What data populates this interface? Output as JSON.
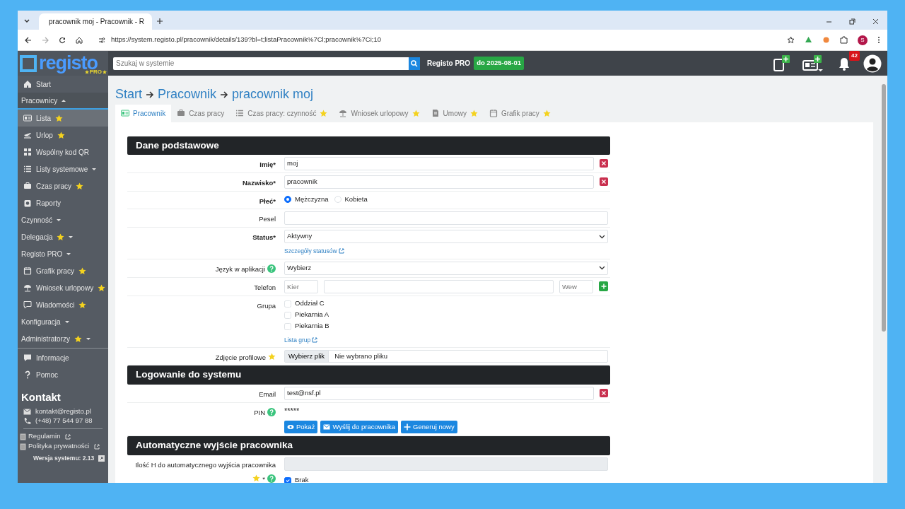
{
  "browser": {
    "tab_title": "pracownik moj - Pracownik - R",
    "url": "https://system.registo.pl/pracownik/details/139?bl=t;listaPracownik%7Cl;pracownik%7Ci;10",
    "profile_initial": "S"
  },
  "header": {
    "logo": "registo",
    "logo_badge": "PRO",
    "search_placeholder": "Szukaj w systemie",
    "plan": "Registo PRO",
    "expiry": "do 2025-08-01",
    "notifications": "42"
  },
  "sidebar": {
    "items": [
      {
        "kind": "link",
        "label": "Start",
        "starred": false,
        "selected": false
      },
      {
        "kind": "section",
        "label": "Pracownicy",
        "expanded": true
      },
      {
        "kind": "link",
        "label": "Lista",
        "starred": true,
        "selected": true
      },
      {
        "kind": "link",
        "label": "Urlop",
        "starred": true,
        "selected": false
      },
      {
        "kind": "link",
        "label": "Wspólny kod QR",
        "starred": false,
        "selected": false
      },
      {
        "kind": "link",
        "label": "Listy systemowe",
        "starred": false,
        "selected": false,
        "expanded": false
      },
      {
        "kind": "link",
        "label": "Czas pracy",
        "starred": true,
        "selected": false
      },
      {
        "kind": "link",
        "label": "Raporty",
        "starred": false,
        "selected": false
      },
      {
        "kind": "section",
        "label": "Czynność",
        "expanded": false
      },
      {
        "kind": "section",
        "label": "Delegacja",
        "starred": true,
        "expanded": false
      },
      {
        "kind": "section",
        "label": "Registo PRO",
        "expanded": false
      },
      {
        "kind": "link",
        "label": "Grafik pracy",
        "starred": true,
        "selected": false
      },
      {
        "kind": "link",
        "label": "Wniosek urlopowy",
        "starred": true,
        "selected": false
      },
      {
        "kind": "link",
        "label": "Wiadomości",
        "starred": true,
        "selected": false
      },
      {
        "kind": "section",
        "label": "Konfiguracja",
        "expanded": false
      },
      {
        "kind": "section",
        "label": "Administratorzy",
        "starred": true,
        "expanded": false
      }
    ],
    "footer_items": [
      {
        "label": "Informacje"
      },
      {
        "label": "Pomoc"
      }
    ],
    "contact": {
      "title": "Kontakt",
      "email": "kontakt@registo.pl",
      "phone": "(+48) 77 544 97 88",
      "links": [
        "Regulamin",
        "Polityka prywatności"
      ],
      "version": "Wersja systemu: 2.13"
    }
  },
  "breadcrumb": [
    "Start",
    "Pracownik",
    "pracownik moj"
  ],
  "tabs": [
    {
      "label": "Pracownik",
      "starred": false,
      "selected": true
    },
    {
      "label": "Czas pracy",
      "starred": false,
      "selected": false
    },
    {
      "label": "Czas pracy: czynność",
      "starred": true,
      "selected": false
    },
    {
      "label": "Wniosek urlopowy",
      "starred": true,
      "selected": false
    },
    {
      "label": "Umowy",
      "starred": true,
      "selected": false
    },
    {
      "label": "Grafik pracy",
      "starred": true,
      "selected": false
    }
  ],
  "sections": [
    {
      "title": "Dane podstawowe",
      "rows": [
        {
          "kind": "text",
          "label": "Imię*",
          "required": true,
          "value": "moj",
          "clearable": true
        },
        {
          "kind": "text",
          "label": "Nazwisko*",
          "required": true,
          "value": "pracownik",
          "clearable": true
        },
        {
          "kind": "radio",
          "label": "Płeć*",
          "required": true,
          "options": [
            {
              "label": "Mężczyzna",
              "selected": true
            },
            {
              "label": "Kobieta",
              "selected": false
            }
          ]
        },
        {
          "kind": "text",
          "label": "Pesel",
          "required": false,
          "value": "",
          "clearable": false
        },
        {
          "kind": "select",
          "label": "Status*",
          "required": true,
          "value": "Aktywny",
          "link": "Szczegóły statusów"
        },
        {
          "kind": "select",
          "label": "Język w aplikacji",
          "required": false,
          "help": true,
          "value": "Wybierz"
        },
        {
          "kind": "phone",
          "label": "Telefon",
          "required": false,
          "prefix_placeholder": "Kier",
          "extension_placeholder": "Wew"
        },
        {
          "kind": "checks",
          "label": "Grupa",
          "required": false,
          "options": [
            {
              "label": "Oddział C",
              "checked": false
            },
            {
              "label": "Piekarnia A",
              "checked": false
            },
            {
              "label": "Piekarnia B",
              "checked": false
            }
          ],
          "link": "Lista grup"
        },
        {
          "kind": "file",
          "label": "Zdjęcie profilowe",
          "required": false,
          "starred": true,
          "button": "Wybierz plik",
          "value": "Nie wybrano pliku"
        }
      ]
    },
    {
      "title": "Logowanie do systemu",
      "rows": [
        {
          "kind": "text",
          "label": "Email",
          "required": false,
          "value": "test@nsf.pl",
          "clearable": true
        },
        {
          "kind": "pin",
          "label": "PIN",
          "required": false,
          "help": true,
          "value": "*****",
          "buttons": [
            "Pokaż",
            "Wyślij do pracownika",
            "Generuj nowy"
          ]
        }
      ]
    },
    {
      "title": "Automatyczne wyjście pracownika",
      "rows": [
        {
          "kind": "hours",
          "label": "Ilość H do automatycznego wyjścia pracownika",
          "required": false,
          "starred": true,
          "suffix": "*",
          "help": true,
          "disabled": true,
          "check": {
            "label": "Brak",
            "checked": true
          }
        }
      ]
    }
  ]
}
